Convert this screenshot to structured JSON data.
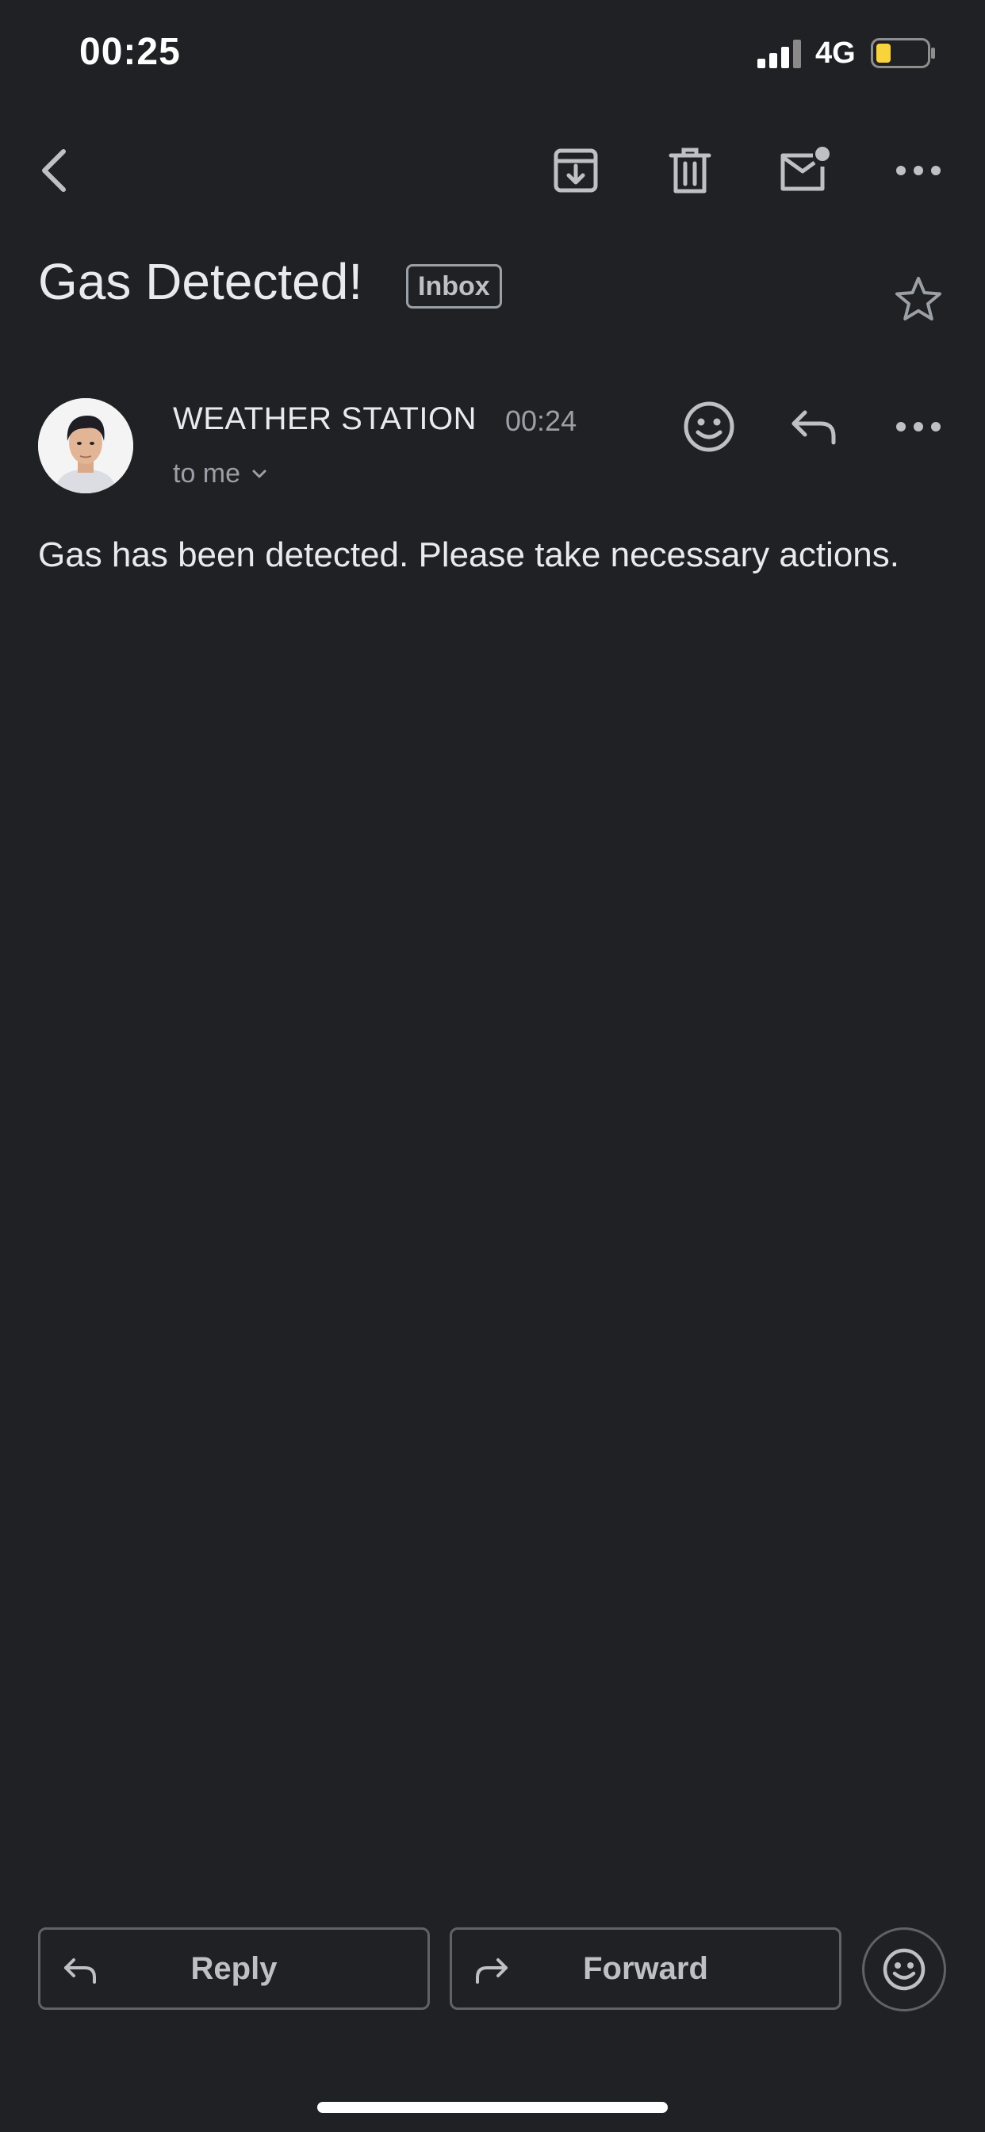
{
  "status_bar": {
    "time": "00:25",
    "network": "4G",
    "battery_color": "#f9d33c"
  },
  "toolbar": {
    "back_icon": "chevron-left-icon",
    "archive_icon": "archive-icon",
    "delete_icon": "trash-icon",
    "mark_unread_icon": "mail-unread-icon",
    "more_icon": "more-horizontal-icon"
  },
  "email": {
    "subject": "Gas Detected!",
    "label": "Inbox",
    "sender": "WEATHER STATION",
    "time": "00:24",
    "recipient": "to me",
    "body": "Gas has been detected. Please take necessary actions."
  },
  "actions": {
    "reply_label": "Reply",
    "forward_label": "Forward"
  },
  "colors": {
    "background": "#202124",
    "text": "#e8eaed",
    "muted": "#9aa0a6",
    "border": "#5f6368"
  }
}
